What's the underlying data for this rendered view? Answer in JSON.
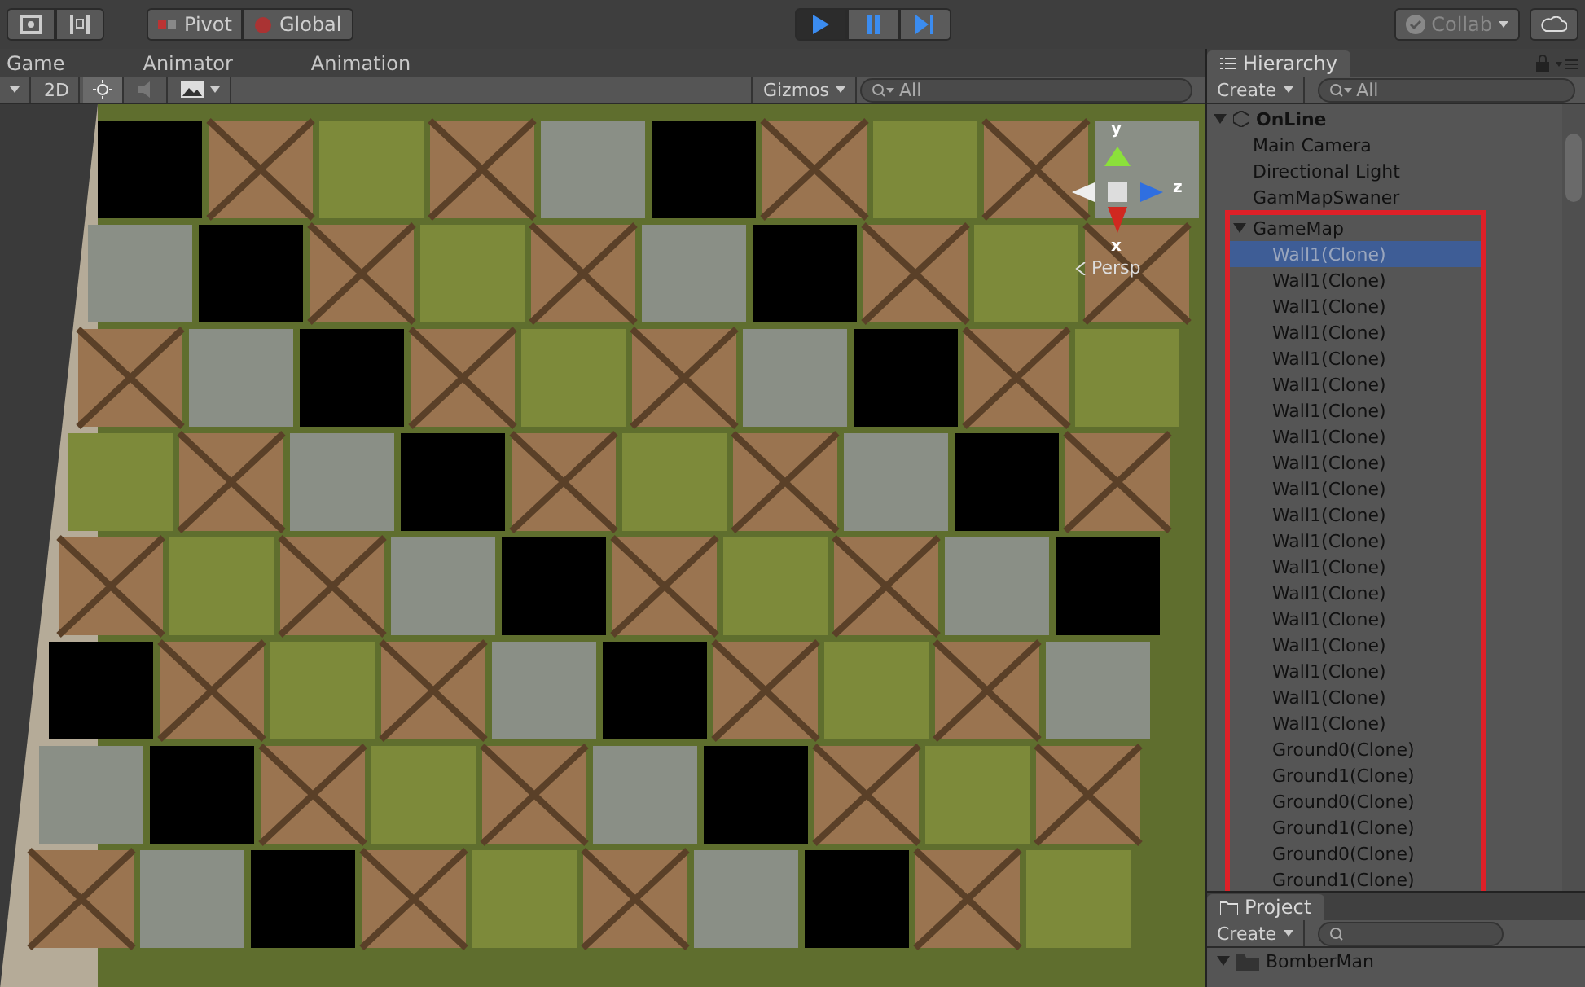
{
  "toolbar": {
    "pivot": "Pivot",
    "global": "Global",
    "play_buttons": [
      {
        "kind": "play",
        "on": true
      },
      {
        "kind": "pause",
        "on": false
      },
      {
        "kind": "step",
        "on": false
      }
    ],
    "collab": "Collab"
  },
  "tabs": [
    {
      "label": "Game",
      "selected": false
    },
    {
      "label": "Animator",
      "selected": false
    },
    {
      "label": "Animation",
      "selected": false
    }
  ],
  "scene_toolbar": {
    "mode": "2D",
    "lighting_on": true,
    "audio_on": false,
    "gizmos": "Gizmos",
    "search": {
      "placeholder": "All"
    }
  },
  "gizmo": {
    "y": "y",
    "z": "z",
    "x": "x",
    "projection": "Persp"
  },
  "hierarchy": {
    "title": "Hierarchy",
    "create": "Create",
    "search": {
      "placeholder": "All"
    },
    "scene": "OnLine",
    "scene_expanded": true,
    "items": [
      {
        "label": "Main Camera",
        "selected": false
      },
      {
        "label": "Directional Light",
        "selected": false
      },
      {
        "label": "GamMapSwaner",
        "selected": false
      },
      {
        "label": "GameMap",
        "selected": false,
        "expanded": true,
        "highlighted": true,
        "children": [
          {
            "label": "Wall1(Clone)",
            "selected": true
          },
          {
            "label": "Wall1(Clone)",
            "selected": false
          },
          {
            "label": "Wall1(Clone)",
            "selected": false
          },
          {
            "label": "Wall1(Clone)",
            "selected": false
          },
          {
            "label": "Wall1(Clone)",
            "selected": false
          },
          {
            "label": "Wall1(Clone)",
            "selected": false
          },
          {
            "label": "Wall1(Clone)",
            "selected": false
          },
          {
            "label": "Wall1(Clone)",
            "selected": false
          },
          {
            "label": "Wall1(Clone)",
            "selected": false
          },
          {
            "label": "Wall1(Clone)",
            "selected": false
          },
          {
            "label": "Wall1(Clone)",
            "selected": false
          },
          {
            "label": "Wall1(Clone)",
            "selected": false
          },
          {
            "label": "Wall1(Clone)",
            "selected": false
          },
          {
            "label": "Wall1(Clone)",
            "selected": false
          },
          {
            "label": "Wall1(Clone)",
            "selected": false
          },
          {
            "label": "Wall1(Clone)",
            "selected": false
          },
          {
            "label": "Wall1(Clone)",
            "selected": false
          },
          {
            "label": "Wall1(Clone)",
            "selected": false
          },
          {
            "label": "Wall1(Clone)",
            "selected": false
          },
          {
            "label": "Ground0(Clone)",
            "selected": false
          },
          {
            "label": "Ground1(Clone)",
            "selected": false
          },
          {
            "label": "Ground0(Clone)",
            "selected": false
          },
          {
            "label": "Ground1(Clone)",
            "selected": false
          },
          {
            "label": "Ground0(Clone)",
            "selected": false
          },
          {
            "label": "Ground1(Clone)",
            "selected": false
          }
        ]
      }
    ]
  },
  "project": {
    "title": "Project",
    "create": "Create",
    "folder": "BomberMan",
    "folder_expanded": true
  }
}
